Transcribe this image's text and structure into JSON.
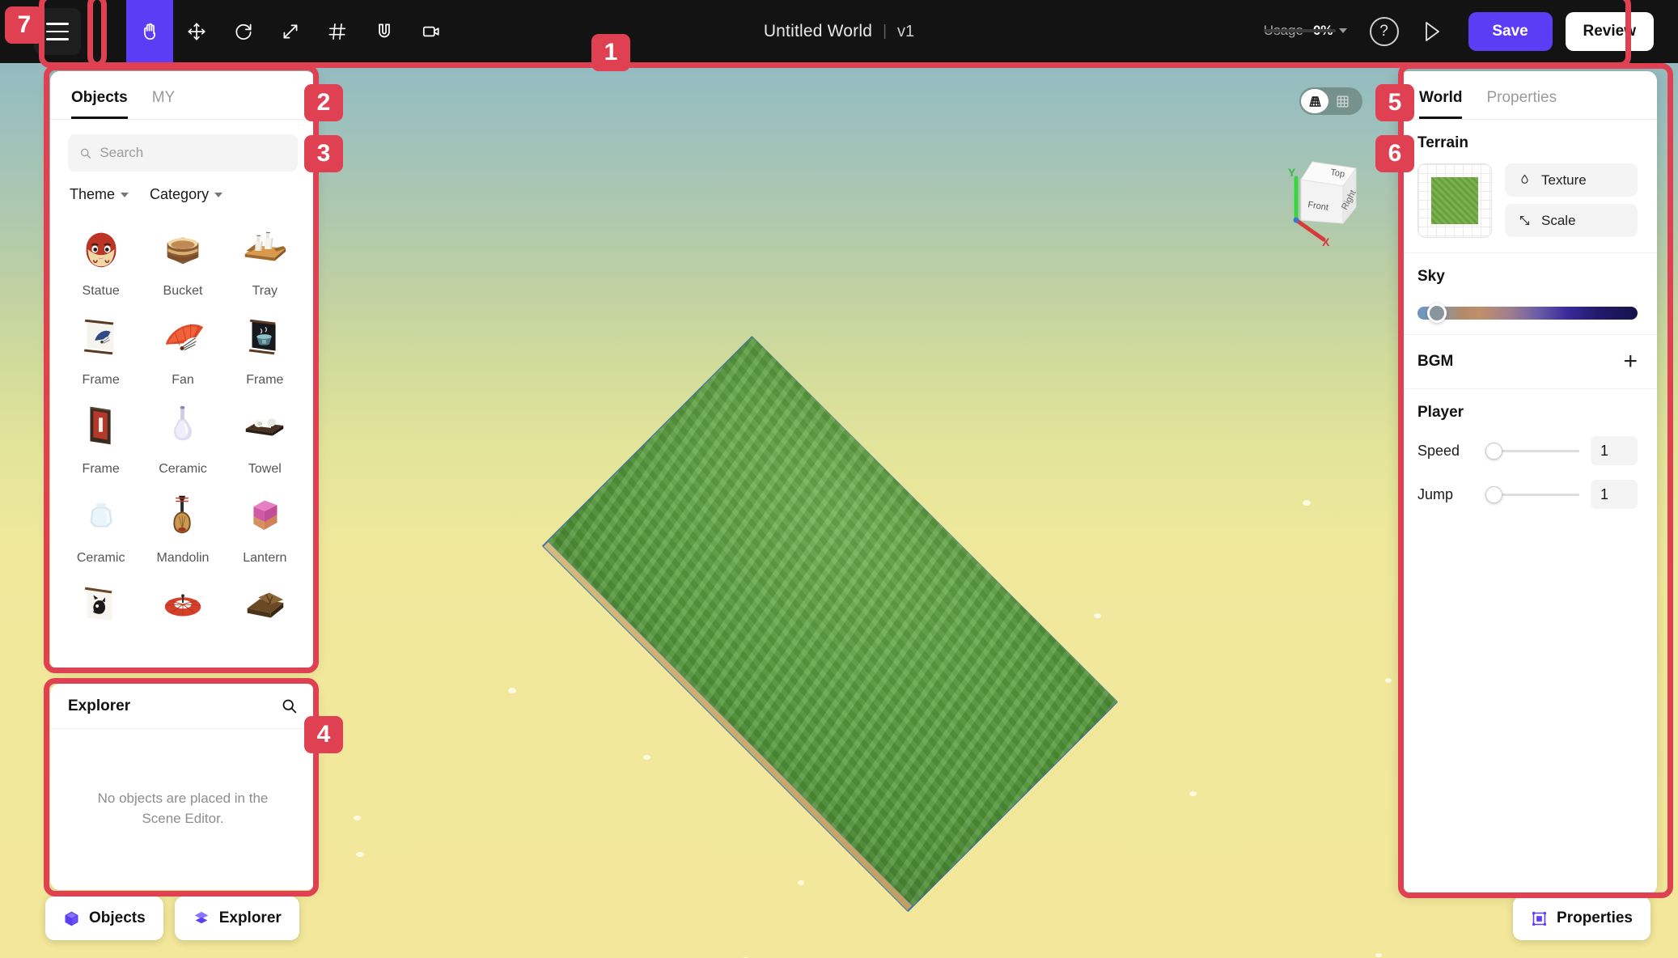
{
  "topbar": {
    "menu_icon": "hamburger-icon",
    "tools": [
      {
        "name": "hand-tool",
        "icon": "hand-icon",
        "active": true
      },
      {
        "name": "move-tool",
        "icon": "move-arrows-icon",
        "active": false
      },
      {
        "name": "rotate-tool",
        "icon": "rotate-icon",
        "active": false
      },
      {
        "name": "scale-tool",
        "icon": "diagonal-arrows-icon",
        "active": false
      },
      {
        "name": "grid-tool",
        "icon": "hash-grid-icon",
        "active": false
      },
      {
        "name": "snap-tool",
        "icon": "magnet-icon",
        "active": false
      },
      {
        "name": "camera-tool",
        "icon": "video-camera-icon",
        "active": false
      }
    ],
    "world_name": "Untitled World",
    "separator": "|",
    "version": "v1",
    "usage_label": "Usage",
    "usage_value": "0%",
    "help_label": "?",
    "save_label": "Save",
    "review_label": "Review",
    "accent": "#5b3df5",
    "background": "#131313"
  },
  "objects_panel": {
    "tabs": [
      {
        "label": "Objects",
        "active": true
      },
      {
        "label": "MY",
        "active": false
      }
    ],
    "search": {
      "value": "",
      "placeholder": "Search"
    },
    "filters": [
      {
        "label": "Theme"
      },
      {
        "label": "Category"
      }
    ],
    "items": [
      {
        "label": "Statue",
        "thumb": "daruma"
      },
      {
        "label": "Bucket",
        "thumb": "bucket"
      },
      {
        "label": "Tray",
        "thumb": "tray"
      },
      {
        "label": "Frame",
        "thumb": "scroll-fan"
      },
      {
        "label": "Fan",
        "thumb": "fan"
      },
      {
        "label": "Frame",
        "thumb": "scroll-bowl"
      },
      {
        "label": "Frame",
        "thumb": "red-frame"
      },
      {
        "label": "Ceramic",
        "thumb": "bottle"
      },
      {
        "label": "Towel",
        "thumb": "towel"
      },
      {
        "label": "Ceramic",
        "thumb": "jar"
      },
      {
        "label": "Mandolin",
        "thumb": "biwa"
      },
      {
        "label": "Lantern",
        "thumb": "lantern"
      },
      {
        "label": "",
        "thumb": "scroll-cat"
      },
      {
        "label": "",
        "thumb": "umbrella"
      },
      {
        "label": "",
        "thumb": "chest"
      }
    ]
  },
  "explorer_panel": {
    "title": "Explorer",
    "search_icon": "search-icon",
    "empty_text": "No objects are placed in the Scene Editor."
  },
  "dock": {
    "objects_label": "Objects",
    "explorer_label": "Explorer",
    "properties_label": "Properties"
  },
  "world_panel": {
    "tabs": [
      {
        "label": "World",
        "active": true
      },
      {
        "label": "Properties",
        "active": false
      }
    ],
    "terrain": {
      "title": "Terrain",
      "texture_label": "Texture",
      "texture_icon": "droplet-icon",
      "scale_label": "Scale",
      "scale_icon": "resize-arrow-icon",
      "swatch_color": "#6aa83c"
    },
    "sky": {
      "title": "Sky",
      "slider_position_pct": 6
    },
    "bgm": {
      "title": "BGM",
      "add_icon": "plus-icon"
    },
    "player": {
      "title": "Player",
      "rows": [
        {
          "label": "Speed",
          "value": "1",
          "position_pct": 0
        },
        {
          "label": "Jump",
          "value": "1",
          "position_pct": 0
        }
      ]
    }
  },
  "viewport": {
    "view_modes": [
      {
        "name": "perspective-grid",
        "active": true
      },
      {
        "name": "flat-grid",
        "active": false
      }
    ],
    "viewcube": {
      "top_label": "Top",
      "front_label": "Front",
      "right_label": "Right",
      "axis_x": "X",
      "axis_y": "Y"
    }
  },
  "annotations": [
    {
      "id": "1"
    },
    {
      "id": "2"
    },
    {
      "id": "3"
    },
    {
      "id": "4"
    },
    {
      "id": "5"
    },
    {
      "id": "6"
    },
    {
      "id": "7"
    }
  ]
}
